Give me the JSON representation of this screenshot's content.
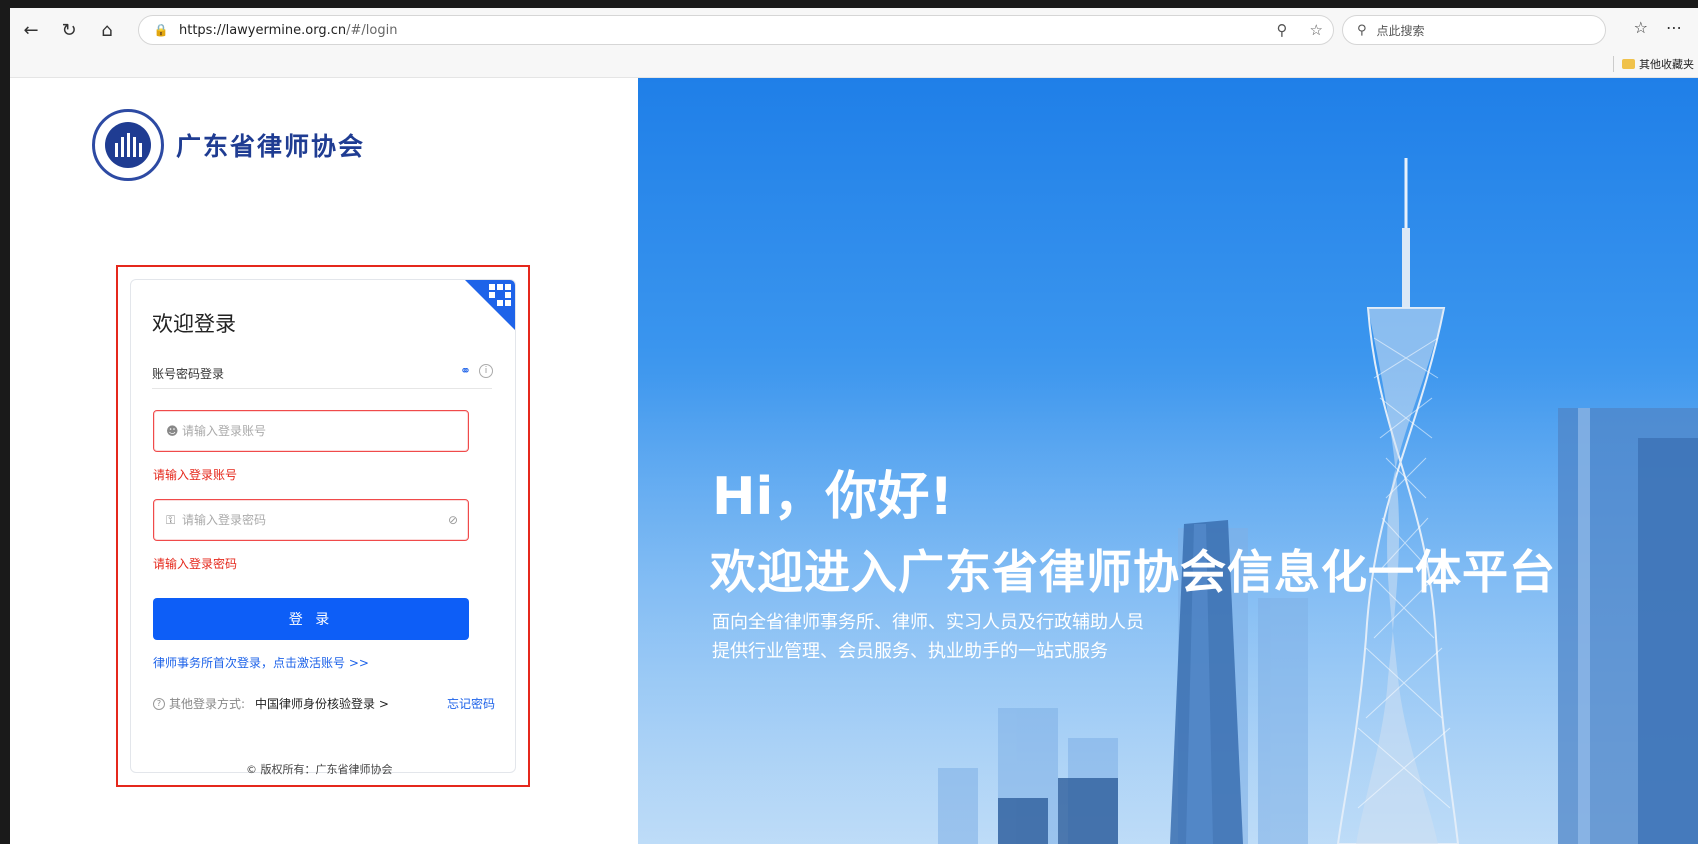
{
  "browser": {
    "url_host": "https://lawyermine.org.cn",
    "url_path": "/#/login",
    "search_placeholder": "点此搜索",
    "bookmark_folder": "其他收藏夹"
  },
  "brand": {
    "name": "广东省律师协会"
  },
  "login": {
    "title": "欢迎登录",
    "tab": "账号密码登录",
    "account_placeholder": "请输入登录账号",
    "account_error": "请输入登录账号",
    "password_placeholder": "请输入登录密码",
    "password_error": "请输入登录密码",
    "submit": "登 录",
    "activate_link": "律师事务所首次登录，点击激活账号 >>",
    "other_label": "其他登录方式:",
    "other_option": "中国律师身份核验登录 >",
    "forgot": "忘记密码"
  },
  "footer": {
    "copyright": "© 版权所有：广东省律师协会"
  },
  "hero": {
    "hi": "Hi，你好!",
    "welcome": "欢迎进入广东省律师协会信息化一体平台",
    "line1": "面向全省律师事务所、律师、实习人员及行政辅助人员",
    "line2": "提供行业管理、会员服务、执业助手的一站式服务"
  },
  "colors": {
    "primary": "#0d5ef7",
    "error": "#e5281c",
    "brand": "#1f3c92"
  }
}
